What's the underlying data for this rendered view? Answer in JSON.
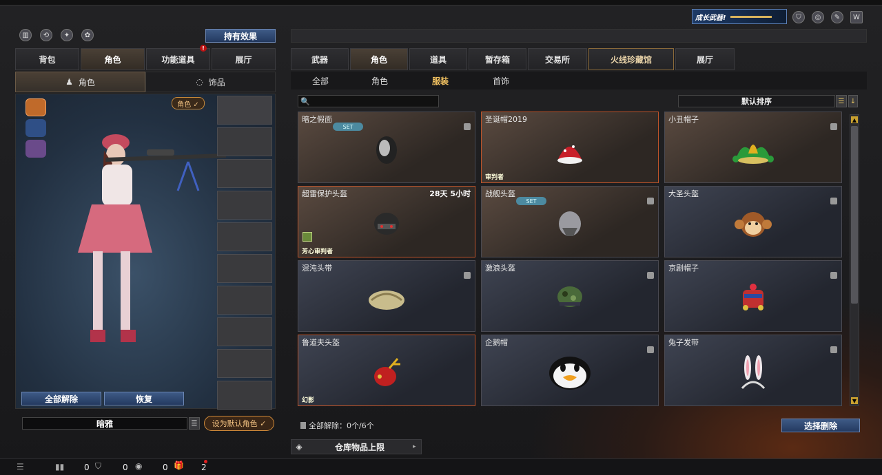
{
  "top_right_banner": "成长武器!",
  "effects_button": "持有效果",
  "left_tabs": [
    {
      "label": "背包"
    },
    {
      "label": "角色"
    },
    {
      "label": "功能道具"
    },
    {
      "label": "展厅"
    }
  ],
  "left_subtabs": [
    {
      "label": "角色",
      "icon": "character-icon"
    },
    {
      "label": "饰品",
      "icon": "ring-icon"
    }
  ],
  "role_badge": "角色 ✓",
  "unequip_all_button": "全部解除",
  "restore_button": "恢复",
  "character_name": "暗雅",
  "set_default_button": "设为默认角色 ✓",
  "main_tabs": [
    {
      "label": "武器"
    },
    {
      "label": "角色"
    },
    {
      "label": "道具"
    },
    {
      "label": "暂存箱"
    },
    {
      "label": "交易所"
    },
    {
      "label": "火线珍藏馆"
    },
    {
      "label": "展厅"
    }
  ],
  "category_tabs": [
    {
      "label": "全部"
    },
    {
      "label": "角色"
    },
    {
      "label": "服装"
    },
    {
      "label": "首饰"
    }
  ],
  "search": {
    "placeholder": ""
  },
  "sort_label": "默认排序",
  "items": [
    {
      "name": "暗之假面",
      "set": "SET",
      "time": "",
      "tag": ""
    },
    {
      "name": "圣诞帽2019",
      "set": "",
      "time": "",
      "tag": "审判者"
    },
    {
      "name": "小丑帽子",
      "set": "",
      "time": "",
      "tag": ""
    },
    {
      "name": "超雷保护头盔",
      "set": "",
      "time": "28天 5小时",
      "tag": "芳心审判者"
    },
    {
      "name": "战舰头盔",
      "set": "SET",
      "time": "",
      "tag": ""
    },
    {
      "name": "大圣头盔",
      "set": "",
      "time": "",
      "tag": ""
    },
    {
      "name": "混沌头带",
      "set": "",
      "time": "",
      "tag": ""
    },
    {
      "name": "激浪头盔",
      "set": "",
      "time": "",
      "tag": ""
    },
    {
      "name": "京剧帽子",
      "set": "",
      "time": "",
      "tag": ""
    },
    {
      "name": "鲁道夫头盔",
      "set": "",
      "time": "",
      "tag": "幻影"
    },
    {
      "name": "企鹅帽",
      "set": "",
      "time": "",
      "tag": ""
    },
    {
      "name": "兔子发带",
      "set": "",
      "time": "",
      "tag": ""
    }
  ],
  "unequip_status": "全部解除：0个/6个",
  "select_delete_button": "选择删除",
  "warehouse_limit": "仓库物品上限",
  "bottom": {
    "val1": "0",
    "val2": "0",
    "val3": "0",
    "gift_count": "2"
  }
}
